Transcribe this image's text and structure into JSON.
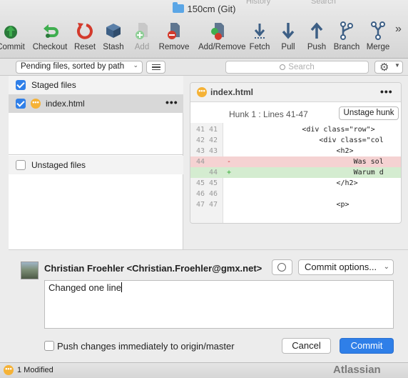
{
  "window": {
    "title": "150cm (Git)",
    "top_tabs": [
      "History",
      "Search"
    ]
  },
  "toolbar": {
    "buttons": [
      {
        "label": "Commit",
        "icon": "commit-icon"
      },
      {
        "label": "Checkout",
        "icon": "checkout-icon"
      },
      {
        "label": "Reset",
        "icon": "reset-icon"
      },
      {
        "label": "Stash",
        "icon": "stash-icon"
      },
      {
        "label": "Add",
        "icon": "add-icon"
      },
      {
        "label": "Remove",
        "icon": "remove-icon"
      },
      {
        "label": "Add/Remove",
        "icon": "add-remove-icon"
      },
      {
        "label": "Fetch",
        "icon": "fetch-icon"
      },
      {
        "label": "Pull",
        "icon": "pull-icon"
      },
      {
        "label": "Push",
        "icon": "push-icon"
      },
      {
        "label": "Branch",
        "icon": "branch-icon"
      },
      {
        "label": "Merge",
        "icon": "merge-icon"
      }
    ],
    "overflow": "»"
  },
  "filterbar": {
    "sort_label": "Pending files, sorted by path",
    "search_placeholder": "Search"
  },
  "files": {
    "staged_header": "Staged files",
    "staged_items": [
      {
        "name": "index.html",
        "status_icon": "modified-icon"
      }
    ],
    "unstaged_header": "Unstaged files"
  },
  "diff": {
    "file_name": "index.html",
    "hunk_title": "Hunk 1 : Lines 41-47",
    "unstage_label": "Unstage hunk",
    "lines": [
      {
        "old": "41",
        "new": "41",
        "sign": "",
        "code": "                <div class=\"row\">",
        "type": "ctx"
      },
      {
        "old": "42",
        "new": "42",
        "sign": "",
        "code": "                    <div class=\"col",
        "type": "ctx"
      },
      {
        "old": "43",
        "new": "43",
        "sign": "",
        "code": "                        <h2>",
        "type": "ctx"
      },
      {
        "old": "44",
        "new": "",
        "sign": "-",
        "code": "                            Was sol",
        "type": "del"
      },
      {
        "old": "",
        "new": "44",
        "sign": "+",
        "code": "                            Warum d",
        "type": "add"
      },
      {
        "old": "45",
        "new": "45",
        "sign": "",
        "code": "                        </h2>",
        "type": "ctx"
      },
      {
        "old": "46",
        "new": "46",
        "sign": "",
        "code": "",
        "type": "ctx"
      },
      {
        "old": "47",
        "new": "47",
        "sign": "",
        "code": "                        <p>",
        "type": "ctx"
      }
    ]
  },
  "commit": {
    "author": "Christian Froehler <Christian.Froehler@gmx.net>",
    "options_label": "Commit options...",
    "message": "Changed one line",
    "push_label": "Push changes immediately to origin/master",
    "cancel_label": "Cancel",
    "commit_label": "Commit"
  },
  "status": {
    "modified": "1 Modified",
    "brand": "Atlassian"
  },
  "colors": {
    "accent": "#2f7fe8",
    "deleted_bg": "#f5d2d2",
    "added_bg": "#d4ecd0",
    "modified": "#f5b236"
  }
}
